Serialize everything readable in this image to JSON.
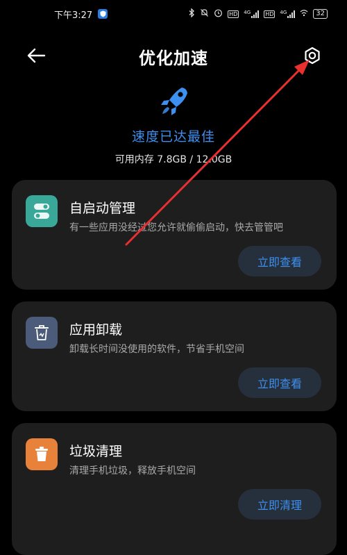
{
  "status_bar": {
    "time": "下午3:27",
    "network_1": "4G",
    "network_2": "4G",
    "hd_1": "HD",
    "hd_2": "HD",
    "battery": "32"
  },
  "header": {
    "title": "优化加速"
  },
  "hero": {
    "status": "速度已达最佳",
    "memory": "可用内存 7.8GB / 12.0GB"
  },
  "cards": [
    {
      "title": "自启动管理",
      "description": "有一些应用没经过您允许就偷偷启动，快去管管吧",
      "button": "立即查看",
      "icon": "toggle-icon",
      "color": "#3aa899"
    },
    {
      "title": "应用卸载",
      "description": "卸载长时间没使用的软件，节省手机空间",
      "button": "立即查看",
      "icon": "trash-box-icon",
      "color": "#4b5b79"
    },
    {
      "title": "垃圾清理",
      "description": "清理手机垃圾，释放手机空间",
      "button": "立即清理",
      "icon": "trash-icon",
      "color": "#e8823b"
    }
  ],
  "colors": {
    "accent": "#3d8ff0",
    "card_bg": "#1e1e1e",
    "annotation": "#e8302e"
  }
}
